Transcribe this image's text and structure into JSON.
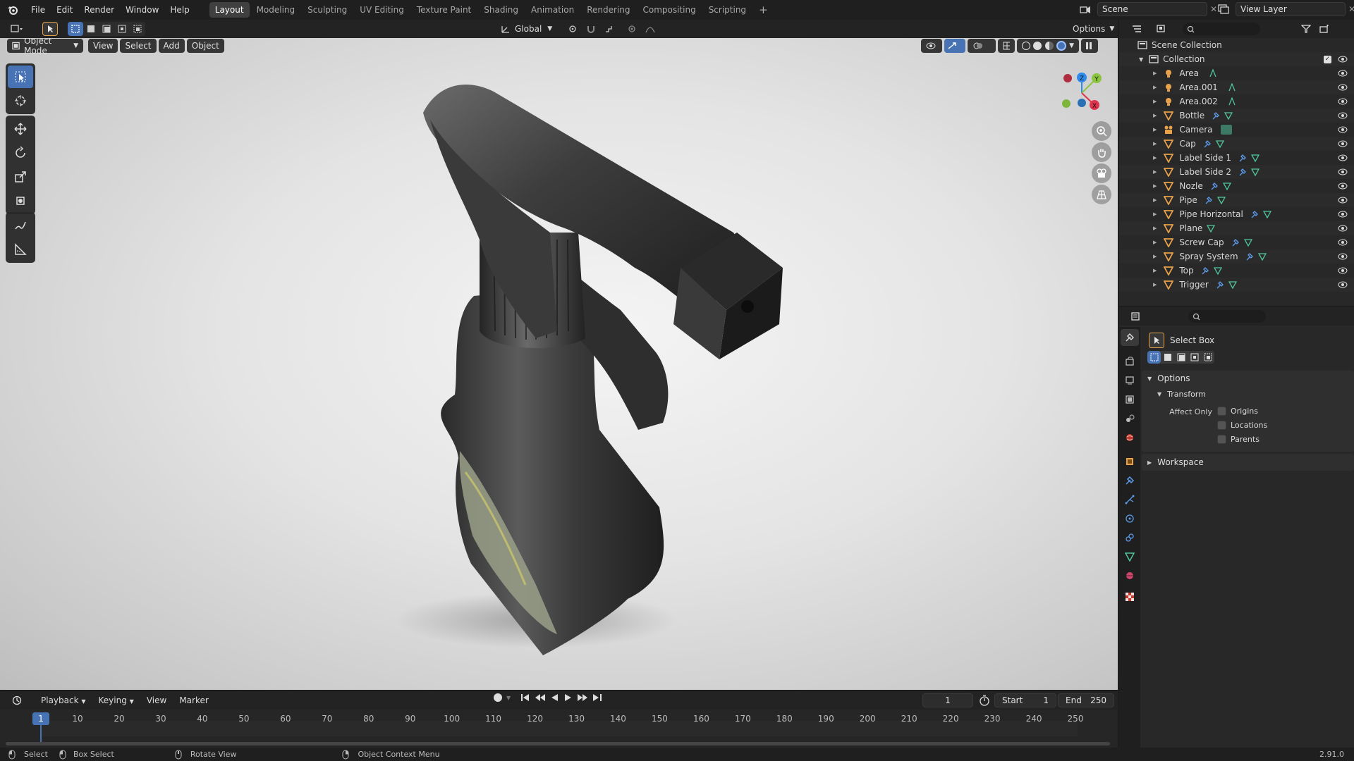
{
  "topbar": {
    "menus": [
      "File",
      "Edit",
      "Render",
      "Window",
      "Help"
    ],
    "workspaces": [
      "Layout",
      "Modeling",
      "Sculpting",
      "UV Editing",
      "Texture Paint",
      "Shading",
      "Animation",
      "Rendering",
      "Compositing",
      "Scripting"
    ],
    "active_workspace": "Layout",
    "add_tab": "+",
    "scene_name": "Scene",
    "view_layer_name": "View Layer"
  },
  "toolheader": {
    "orientation": "Global",
    "options": "Options"
  },
  "viewport": {
    "mode": "Object Mode",
    "menus": [
      "View",
      "Select",
      "Add",
      "Object"
    ],
    "gizmo_labels": {
      "z": "Z",
      "y": "Y",
      "x": "X"
    },
    "tools": [
      "select-box-tool",
      "cursor-tool",
      "move-tool",
      "rotate-tool",
      "scale-tool",
      "transform-tool",
      "annotate-tool",
      "measure-tool"
    ]
  },
  "outliner": {
    "root": "Scene Collection",
    "collection": "Collection",
    "items": [
      {
        "name": "Area",
        "type": "light"
      },
      {
        "name": "Area.001",
        "type": "light"
      },
      {
        "name": "Area.002",
        "type": "light"
      },
      {
        "name": "Bottle",
        "type": "mesh"
      },
      {
        "name": "Camera",
        "type": "camera"
      },
      {
        "name": "Cap",
        "type": "mesh"
      },
      {
        "name": "Label Side 1",
        "type": "mesh"
      },
      {
        "name": "Label Side 2",
        "type": "mesh"
      },
      {
        "name": "Nozle",
        "type": "mesh"
      },
      {
        "name": "Pipe",
        "type": "mesh"
      },
      {
        "name": "Pipe Horizontal",
        "type": "mesh"
      },
      {
        "name": "Plane",
        "type": "mesh"
      },
      {
        "name": "Screw Cap",
        "type": "mesh"
      },
      {
        "name": "Spray System",
        "type": "mesh"
      },
      {
        "name": "Top",
        "type": "mesh"
      },
      {
        "name": "Trigger",
        "type": "mesh"
      }
    ]
  },
  "properties": {
    "tool_name": "Select Box",
    "options_label": "Options",
    "transform_label": "Transform",
    "affect_only_label": "Affect Only",
    "checkboxes": [
      "Origins",
      "Locations",
      "Parents"
    ],
    "workspace_label": "Workspace"
  },
  "timeline": {
    "menus": [
      "Playback",
      "Keying",
      "View",
      "Marker"
    ],
    "current_frame": "1",
    "start_label": "Start",
    "start_value": "1",
    "end_label": "End",
    "end_value": "250",
    "ruler": [
      "1",
      "10",
      "20",
      "30",
      "40",
      "50",
      "60",
      "70",
      "80",
      "90",
      "100",
      "110",
      "120",
      "130",
      "140",
      "150",
      "160",
      "170",
      "180",
      "190",
      "200",
      "210",
      "220",
      "230",
      "240",
      "250"
    ]
  },
  "status": {
    "select": "Select",
    "box_select": "Box Select",
    "rotate_view": "Rotate View",
    "context_menu": "Object Context Menu",
    "version": "2.91.0"
  },
  "colors": {
    "accent": "#4772b3",
    "axis_x": "#e0334d",
    "axis_y": "#8bc53f",
    "axis_z": "#2d8ceb",
    "object_orange": "#e8a24a",
    "data_green": "#4fc79a"
  }
}
